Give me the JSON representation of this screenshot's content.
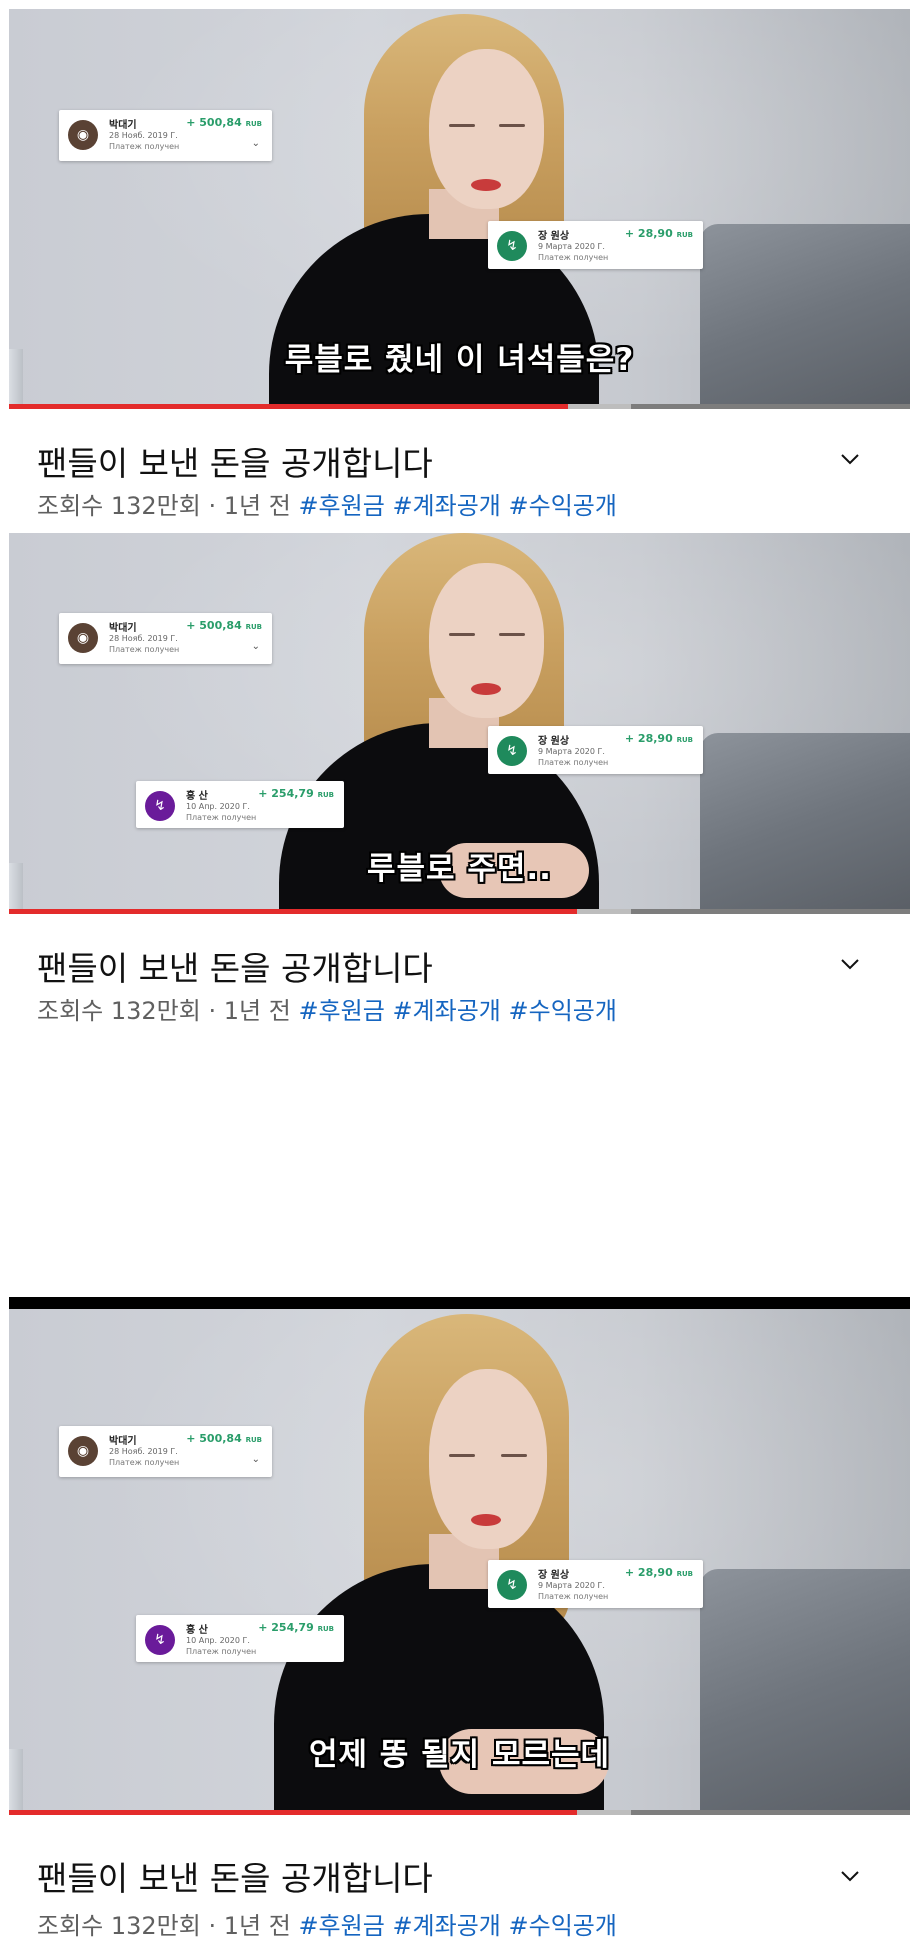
{
  "frames": [
    {
      "subtitle": "루블로 줬네 이 녀석들은?",
      "progress": 0.62,
      "cards": [
        {
          "name": "박대기",
          "date": "28 Нояб. 2019 Г.",
          "status": "Платеж получен",
          "amount": "+ 500,84",
          "currency": "RUB"
        },
        {
          "name": "장 원상",
          "date": "9 Марта 2020 Г.",
          "status": "Платеж получен",
          "amount": "+ 28,90",
          "currency": "RUB"
        }
      ]
    },
    {
      "subtitle": "루블로 주면..",
      "progress": 0.63,
      "cards": [
        {
          "name": "박대기",
          "date": "28 Нояб. 2019 Г.",
          "status": "Платеж получен",
          "amount": "+ 500,84",
          "currency": "RUB"
        },
        {
          "name": "장 원상",
          "date": "9 Марта 2020 Г.",
          "status": "Платеж получен",
          "amount": "+ 28,90",
          "currency": "RUB"
        },
        {
          "name": "홍 산",
          "date": "10 Апр. 2020 Г.",
          "status": "Платеж получен",
          "amount": "+ 254,79",
          "currency": "RUB"
        }
      ]
    },
    {
      "subtitle": "언제 똥 될지 모르는데",
      "progress": 0.63,
      "cards": [
        {
          "name": "박대기",
          "date": "28 Нояб. 2019 Г.",
          "status": "Платеж получен",
          "amount": "+ 500,84",
          "currency": "RUB"
        },
        {
          "name": "장 원상",
          "date": "9 Марта 2020 Г.",
          "status": "Платеж получен",
          "amount": "+ 28,90",
          "currency": "RUB"
        },
        {
          "name": "홍 산",
          "date": "10 Апр. 2020 Г.",
          "status": "Платеж получен",
          "amount": "+ 254,79",
          "currency": "RUB"
        }
      ]
    }
  ],
  "video_info": {
    "title": "팬들이 보낸 돈을 공개합니다",
    "views": "조회수 132만회 · 1년 전",
    "tags": [
      "#후원금",
      "#계좌공개",
      "#수익공개"
    ]
  },
  "colors": {
    "progress": "#e32b2b",
    "hashtag": "#1565c0",
    "amount": "#2a9d6a"
  }
}
